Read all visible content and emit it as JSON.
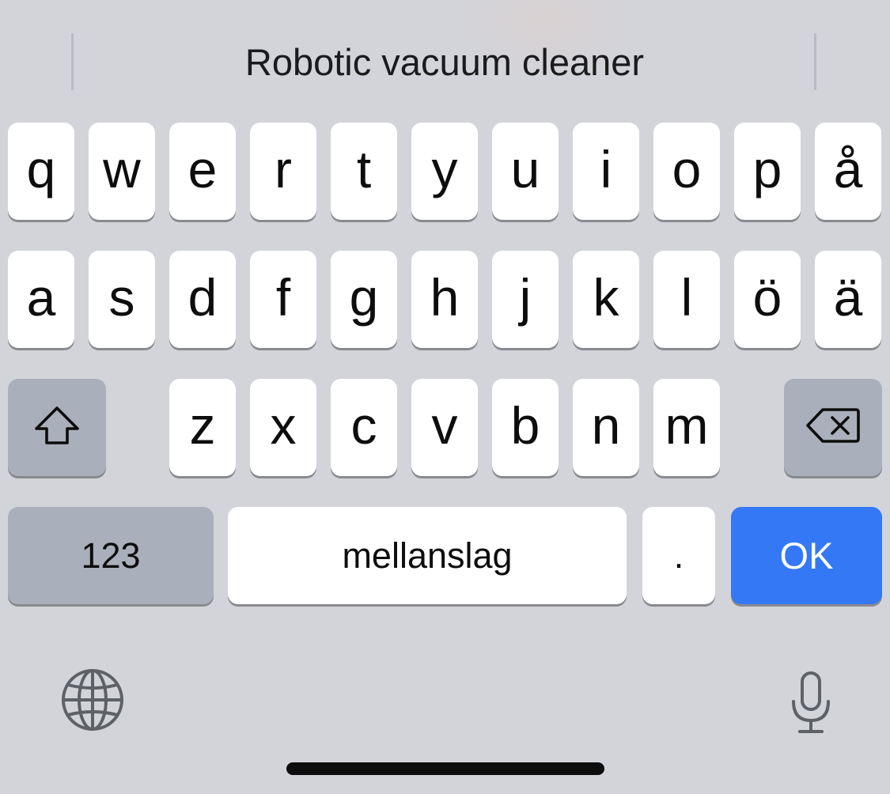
{
  "suggestion_bar": {
    "suggestion": "Robotic vacuum cleaner"
  },
  "keyboard": {
    "row1": [
      "q",
      "w",
      "e",
      "r",
      "t",
      "y",
      "u",
      "i",
      "o",
      "p",
      "å"
    ],
    "row2": [
      "a",
      "s",
      "d",
      "f",
      "g",
      "h",
      "j",
      "k",
      "l",
      "ö",
      "ä"
    ],
    "row3": [
      "z",
      "x",
      "c",
      "v",
      "b",
      "n",
      "m"
    ],
    "shift_icon": "shift-arrow-icon",
    "delete_icon": "backspace-icon",
    "numbers_label": "123",
    "space_label": "mellanslag",
    "period_label": ".",
    "return_label": "OK",
    "globe_icon": "globe-icon",
    "mic_icon": "microphone-icon"
  },
  "colors": {
    "background": "#d2d4da",
    "key": "#ffffff",
    "function_key": "#aab0bb",
    "accent": "#3478f6"
  }
}
